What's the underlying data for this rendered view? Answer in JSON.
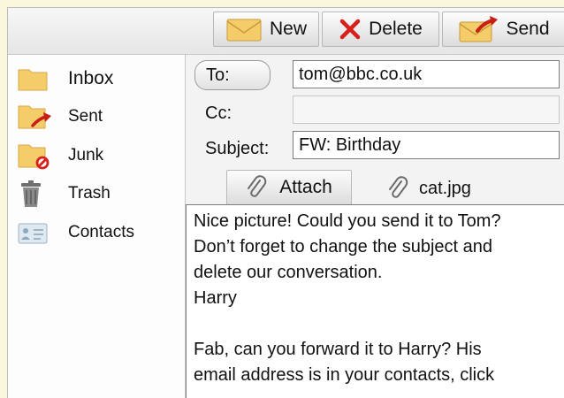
{
  "toolbar": {
    "new_label": "New",
    "delete_label": "Delete",
    "send_label": "Send"
  },
  "sidebar": {
    "items": [
      {
        "label": "Inbox",
        "icon": "inbox-folder-icon"
      },
      {
        "label": "Sent",
        "icon": "sent-folder-icon"
      },
      {
        "label": "Junk",
        "icon": "junk-folder-icon"
      },
      {
        "label": "Trash",
        "icon": "trash-icon"
      },
      {
        "label": "Contacts",
        "icon": "contacts-card-icon"
      }
    ]
  },
  "compose": {
    "to_label": "To:",
    "to_value": "tom@bbc.co.uk",
    "cc_label": "Cc:",
    "cc_value": "",
    "subject_label": "Subject:",
    "subject_value": "FW: Birthday",
    "attach_label": "Attach",
    "attachment_name": "cat.jpg"
  },
  "message": {
    "lines": [
      "Nice picture! Could you send it to Tom?",
      "Don’t forget to change the subject and",
      "delete our conversation.",
      "Harry",
      "",
      "Fab, can you forward it to Harry? His",
      "email address is in your contacts, click"
    ]
  },
  "colors": {
    "background": "#fbf7dc",
    "folder": "#f5cc6a",
    "delete_red": "#d7201c",
    "sent_arrow": "#c81e14"
  }
}
